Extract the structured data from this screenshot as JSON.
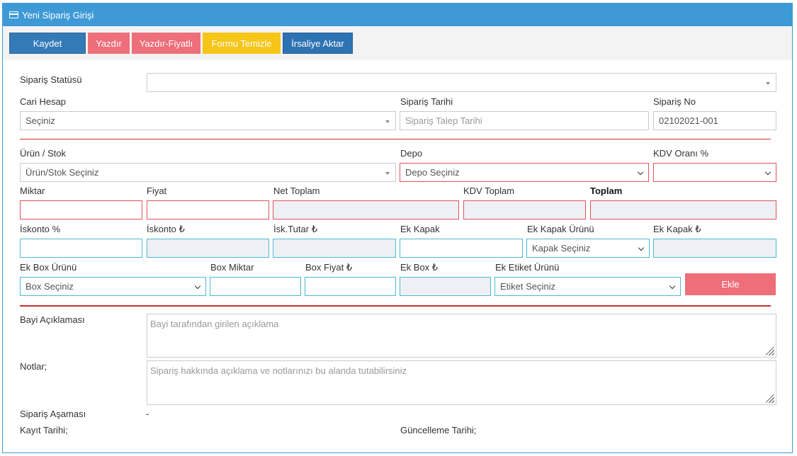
{
  "header": {
    "title": "Yeni Sipariş Girişi",
    "icon": "credit-card-icon"
  },
  "toolbar": {
    "save": "Kaydet",
    "print": "Yazdır",
    "print_price": "Yazdır-Fiyatlı",
    "clear": "Formu Temizle",
    "transfer": "İrsaliye Aktar"
  },
  "colors": {
    "header": "#3d9ad6",
    "save": "#337ab7",
    "print": "#ee6e7a",
    "clear": "#f5c518",
    "transfer": "#2d72b2",
    "divider": "#c9302c"
  },
  "form": {
    "status_label": "Sipariş Statüsü",
    "status_value": "",
    "account_label": "Cari Hesap",
    "account_value": "Seçiniz",
    "order_date_label": "Sipariş Tarihi",
    "order_date_placeholder": "Sipariş Talep Tarihi",
    "order_no_label": "Sipariş No",
    "order_no_value": "02102021-001",
    "product_label": "Ürün / Stok",
    "product_value": "Ürün/Stok Seçiniz",
    "depot_label": "Depo",
    "depot_value": "Depo Seçiniz",
    "vat_rate_label": "KDV Oranı %",
    "vat_rate_value": "",
    "qty_label": "Miktar",
    "price_label": "Fiyat",
    "net_total_label": "Net Toplam",
    "vat_total_label": "KDV Toplam",
    "total_label": "Toplam",
    "discount_pct_label": "İskonto %",
    "discount_amt_label": "İskonto ₺",
    "disc_amount_label": "İsk.Tutar ₺",
    "extra_cover_label": "Ek Kapak",
    "extra_cover_product_label": "Ek Kapak Ürünü",
    "extra_cover_product_value": "Kapak Seçiniz",
    "extra_cover_price_label": "Ek Kapak ₺",
    "extra_box_product_label": "Ek Box Ürünü",
    "extra_box_product_value": "Box Seçiniz",
    "box_qty_label": "Box Miktar",
    "box_price_label": "Box Fiyat ₺",
    "extra_box_label": "Ek Box ₺",
    "extra_label_product_label": "Ek Etiket Ürünü",
    "extra_label_product_value": "Etiket Seçiniz",
    "add_button": "Ekle",
    "dealer_note_label": "Bayi Açıklaması",
    "dealer_note_placeholder": "Bayi tarafından girilen açıklama",
    "notes_label": "Notlar;",
    "notes_placeholder": "Sipariş hakkında açıklama ve notlarınızı bu alanda tutabilirsiniz",
    "stage_label": "Sipariş Aşaması",
    "stage_value": "-",
    "created_label": "Kayıt Tarihi;",
    "updated_label": "Güncelleme Tarihi;"
  }
}
